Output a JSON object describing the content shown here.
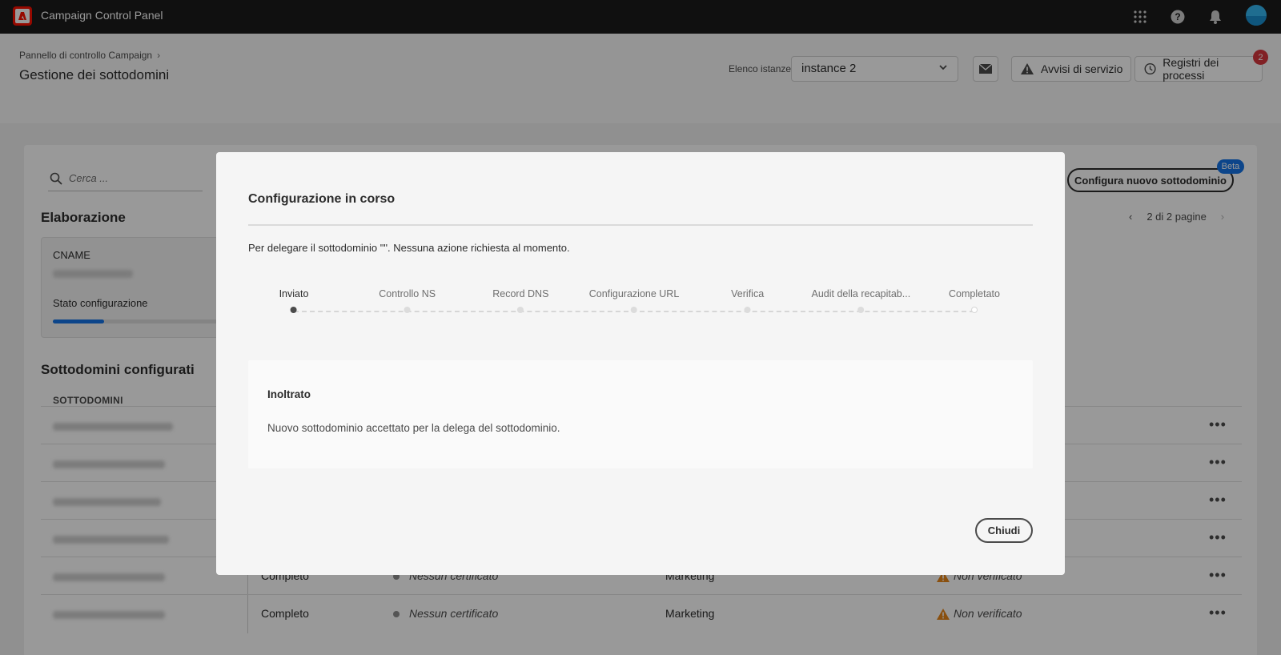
{
  "topbar": {
    "app_title": "Campaign Control Panel",
    "icons": [
      "adobe-logo-icon",
      "apps-grid-icon",
      "help-icon",
      "bell-icon",
      "avatar"
    ]
  },
  "header": {
    "breadcrumb": "Pannello di controllo Campaign",
    "title": "Gestione dei sottodomini",
    "instance_label": "Elenco istanze",
    "instance_value": "instance 2",
    "service_alerts": "Avvisi di servizio",
    "process_logs": "Registri dei processi",
    "notification_count": "2"
  },
  "content": {
    "search_placeholder": "Cerca ...",
    "processing_title": "Elaborazione",
    "cname_label": "CNAME",
    "config_status_label": "Stato configurazione",
    "config_progress": 0.3,
    "new_subdomain_button": "Configura nuovo sottodominio",
    "beta_badge": "Beta",
    "pager_text": "2 di 2 pagine",
    "configured_title": "Sottodomini configurati",
    "column_subdomains": "SOTTODOMINI",
    "rows": [
      {
        "status": "",
        "cert": "",
        "type": "",
        "verification": ""
      },
      {
        "status": "",
        "cert": "",
        "type": "",
        "verification": ""
      },
      {
        "status": "",
        "cert": "",
        "type": "",
        "verification": ""
      },
      {
        "status": "",
        "cert": "",
        "type": "",
        "verification": ""
      },
      {
        "status": "Completo",
        "cert": "Nessun certificato",
        "type": "Marketing",
        "verification": "Non verificato"
      },
      {
        "status": "Completo",
        "cert": "Nessun certificato",
        "type": "Marketing",
        "verification": "Non verificato"
      }
    ]
  },
  "modal": {
    "title": "Configurazione in corso",
    "description": "Per delegare il sottodominio \"\". Nessuna azione richiesta al momento.",
    "steps": [
      "Inviato",
      "Controllo NS",
      "Record DNS",
      "Configurazione URL",
      "Verifica",
      "Audit della recapitab...",
      "Completato"
    ],
    "active_step": 0,
    "info_title": "Inoltrato",
    "info_text": "Nuovo sottodominio accettato per la delega del sottodominio.",
    "close_button": "Chiudi"
  },
  "colors": {
    "accent": "#1473e6",
    "topbar": "#1b1b1b",
    "adobe_red": "#fa0f00",
    "warning": "#e68619"
  }
}
